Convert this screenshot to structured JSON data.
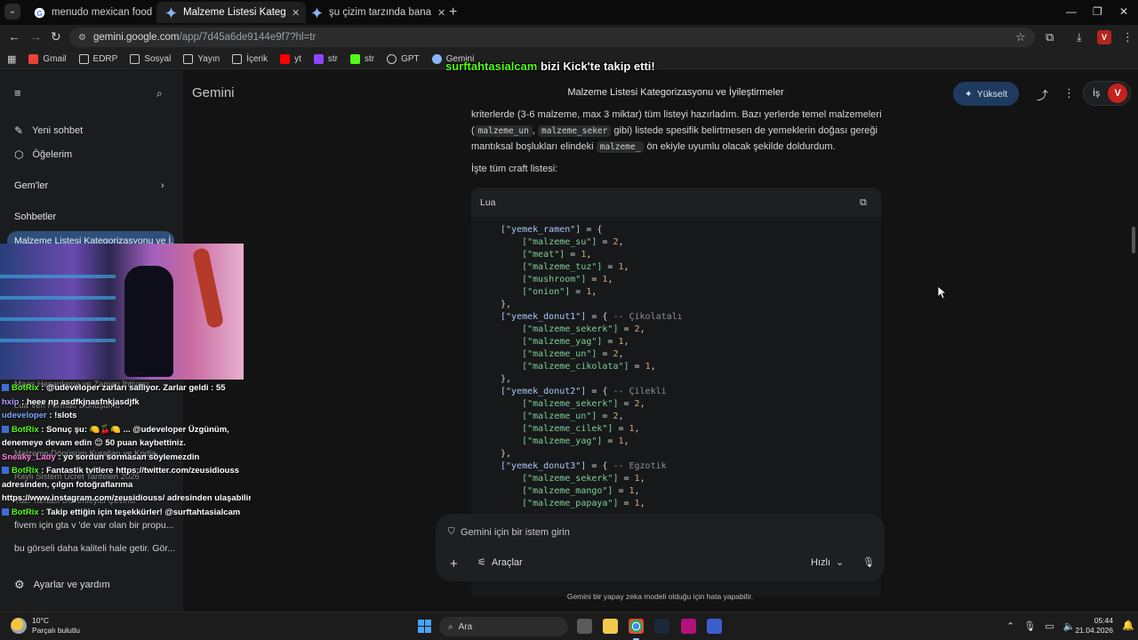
{
  "browser": {
    "tabs": [
      {
        "title": "menudo mexican food - Google",
        "active": false
      },
      {
        "title": "Malzeme Listesi Kategorizasyon",
        "active": true
      },
      {
        "title": "şu çizim tarzında bana arka pla",
        "active": false
      }
    ],
    "url_domain": "gemini.google.com",
    "url_path": "/app/7d45a6de9144e9f7?hl=tr",
    "bookmarks": [
      "Gmail",
      "EDRP",
      "Sosyal",
      "Yayın",
      "İçerik",
      "yt",
      "str",
      "str",
      "GPT",
      "Gemini"
    ]
  },
  "sidebar": {
    "new_chat": "Yeni sohbet",
    "my_items": "Öğelerim",
    "gems": "Gem'ler",
    "chats_header": "Sohbetler",
    "chats": [
      "Malzeme Listesi Kategorizasyonu ve İ...",
      "Lua Veri Formatı Dönüşümü",
      "Malzeme Dönüşüm Kuralları ve Kodla...",
      "Maaş Hesaplama ve Zaman İhtiyacı",
      "Raylı Sistem Ücret Tarifeleri 2026",
      "Yazı Tahtası Düzenleyici Çevirisi",
      "fivem için gta v 'de var olan bir propu...",
      "bu görseli daha kaliteli hale getir. Gör..."
    ],
    "settings": "Ayarlar ve yardım"
  },
  "header": {
    "app_name": "Gemini",
    "conversation_title": "Malzeme Listesi Kategorizasyonu ve İyileştirmeler",
    "upgrade": "Yükselt",
    "account_label": "İş",
    "avatar_letter": "V"
  },
  "message": {
    "line1": "kriterlerde (3-6 malzeme, max 3 miktar) tüm listeyi hazırladım. Bazı yerlerde temel malzemeleri",
    "line2_chip1": "malzeme_un",
    "line2_chip2": "malzeme_seker",
    "line2_rest": "gibi) listede spesifik belirtmesen de yemeklerin doğası gereği",
    "line3_pre": "mantıksal boşlukları elindeki",
    "line3_chip": "malzeme_",
    "line3_post": "ön ekiyle uyumlu olacak şekilde doldurdum.",
    "intro": "İşte tüm craft listesi:"
  },
  "code": {
    "language": "Lua",
    "lines": [
      [
        [
          "k",
          "[\"yemek_ramen\"]"
        ],
        [
          "p",
          " = {"
        ]
      ],
      [
        [
          "p",
          "    "
        ],
        [
          "s",
          "[\"malzeme_su\"]"
        ],
        [
          "p",
          " = "
        ],
        [
          "n",
          "2"
        ],
        [
          "p",
          ","
        ]
      ],
      [
        [
          "p",
          "    "
        ],
        [
          "s",
          "[\"meat\"]"
        ],
        [
          "p",
          " = "
        ],
        [
          "n",
          "1"
        ],
        [
          "p",
          ","
        ]
      ],
      [
        [
          "p",
          "    "
        ],
        [
          "s",
          "[\"malzeme_tuz\"]"
        ],
        [
          "p",
          " = "
        ],
        [
          "n",
          "1"
        ],
        [
          "p",
          ","
        ]
      ],
      [
        [
          "p",
          "    "
        ],
        [
          "s",
          "[\"mushroom\"]"
        ],
        [
          "p",
          " = "
        ],
        [
          "n",
          "1"
        ],
        [
          "p",
          ","
        ]
      ],
      [
        [
          "p",
          "    "
        ],
        [
          "s",
          "[\"onion\"]"
        ],
        [
          "p",
          " = "
        ],
        [
          "n",
          "1"
        ],
        [
          "p",
          ","
        ]
      ],
      [
        [
          "p",
          "},"
        ]
      ],
      [
        [
          "k",
          "[\"yemek_donut1\"]"
        ],
        [
          "p",
          " = { "
        ],
        [
          "c",
          "-- Çikolatalı"
        ]
      ],
      [
        [
          "p",
          "    "
        ],
        [
          "s",
          "[\"malzeme_sekerk\"]"
        ],
        [
          "p",
          " = "
        ],
        [
          "n",
          "2"
        ],
        [
          "p",
          ","
        ]
      ],
      [
        [
          "p",
          "    "
        ],
        [
          "s",
          "[\"malzeme_yag\"]"
        ],
        [
          "p",
          " = "
        ],
        [
          "n",
          "1"
        ],
        [
          "p",
          ","
        ]
      ],
      [
        [
          "p",
          "    "
        ],
        [
          "s",
          "[\"malzeme_un\"]"
        ],
        [
          "p",
          " = "
        ],
        [
          "n",
          "2"
        ],
        [
          "p",
          ","
        ]
      ],
      [
        [
          "p",
          "    "
        ],
        [
          "s",
          "[\"malzeme_cikolata\"]"
        ],
        [
          "p",
          " = "
        ],
        [
          "n",
          "1"
        ],
        [
          "p",
          ","
        ]
      ],
      [
        [
          "p",
          "},"
        ]
      ],
      [
        [
          "k",
          "[\"yemek_donut2\"]"
        ],
        [
          "p",
          " = { "
        ],
        [
          "c",
          "-- Çilekli"
        ]
      ],
      [
        [
          "p",
          "    "
        ],
        [
          "s",
          "[\"malzeme_sekerk\"]"
        ],
        [
          "p",
          " = "
        ],
        [
          "n",
          "2"
        ],
        [
          "p",
          ","
        ]
      ],
      [
        [
          "p",
          "    "
        ],
        [
          "s",
          "[\"malzeme_un\"]"
        ],
        [
          "p",
          " = "
        ],
        [
          "n",
          "2"
        ],
        [
          "p",
          ","
        ]
      ],
      [
        [
          "p",
          "    "
        ],
        [
          "s",
          "[\"malzeme_cilek\"]"
        ],
        [
          "p",
          " = "
        ],
        [
          "n",
          "1"
        ],
        [
          "p",
          ","
        ]
      ],
      [
        [
          "p",
          "    "
        ],
        [
          "s",
          "[\"malzeme_yag\"]"
        ],
        [
          "p",
          " = "
        ],
        [
          "n",
          "1"
        ],
        [
          "p",
          ","
        ]
      ],
      [
        [
          "p",
          "},"
        ]
      ],
      [
        [
          "k",
          "[\"yemek_donut3\"]"
        ],
        [
          "p",
          " = { "
        ],
        [
          "c",
          "-- Egzotik"
        ]
      ],
      [
        [
          "p",
          "    "
        ],
        [
          "s",
          "[\"malzeme_sekerk\"]"
        ],
        [
          "p",
          " = "
        ],
        [
          "n",
          "1"
        ],
        [
          "p",
          ","
        ]
      ],
      [
        [
          "p",
          "    "
        ],
        [
          "s",
          "[\"malzeme_mango\"]"
        ],
        [
          "p",
          " = "
        ],
        [
          "n",
          "1"
        ],
        [
          "p",
          ","
        ]
      ],
      [
        [
          "p",
          "    "
        ],
        [
          "s",
          "[\"malzeme_papaya\"]"
        ],
        [
          "p",
          " = "
        ],
        [
          "n",
          "1"
        ],
        [
          "p",
          ","
        ]
      ]
    ]
  },
  "composer": {
    "placeholder": "Gemini için bir istem girin",
    "tools": "Araçlar",
    "mode": "Hızlı"
  },
  "disclaimer": "Gemini bir yapay zeka modeli olduğu için hata yapabilir.",
  "stream": {
    "alert_name": "surftahtasialcam",
    "alert_text": " bizi Kick'te takip etti!",
    "chat": [
      {
        "user": "BotRix",
        "text": " : @udeveloper zarları salliyor. Zarlar geldi : 55",
        "user_class": "bot"
      },
      {
        "user": "hxip",
        "text": " : heee np asdfkjnasfnkjasdjfk",
        "user_class": "user-a"
      },
      {
        "user": "udeveloper",
        "text": " : !slots",
        "user_class": "user-b"
      },
      {
        "user": "BotRix",
        "text": " : Sonuç şu: 🍋🍒🍋 ... @udeveloper Üzgünüm,",
        "user_class": "bot"
      },
      {
        "user": "",
        "text": "denemeye devam edin 😊 50 puan kaybettiniz.",
        "user_class": ""
      },
      {
        "user": "Sneaky_Lady",
        "text": " : yo sordun sormasan söylemezdin",
        "user_class": "user-c"
      },
      {
        "user": "BotRix",
        "text": " : Fantastik tvitlere https://twitter.com/zeusidiouss",
        "user_class": "bot"
      },
      {
        "user": "",
        "text": "adresinden, çılgın fotoğraflarıma",
        "user_class": ""
      },
      {
        "user": "",
        "text": "https://www.instagram.com/zeusidiouss/ adresinden ulaşabilirsin.",
        "user_class": ""
      },
      {
        "user": "BotRix",
        "text": " : Takip ettiğin için teşekkürler! @surftahtasialcam",
        "user_class": "bot"
      }
    ]
  },
  "taskbar": {
    "temperature": "10°C",
    "weather": "Parçalı bulutlu",
    "search": "Ara",
    "time": "05:44",
    "date": "21.04.2026"
  },
  "colors": {
    "accent": "#a8c7fa",
    "upgrade_bg": "#1f3a5f",
    "kick_green": "#53fc18"
  }
}
